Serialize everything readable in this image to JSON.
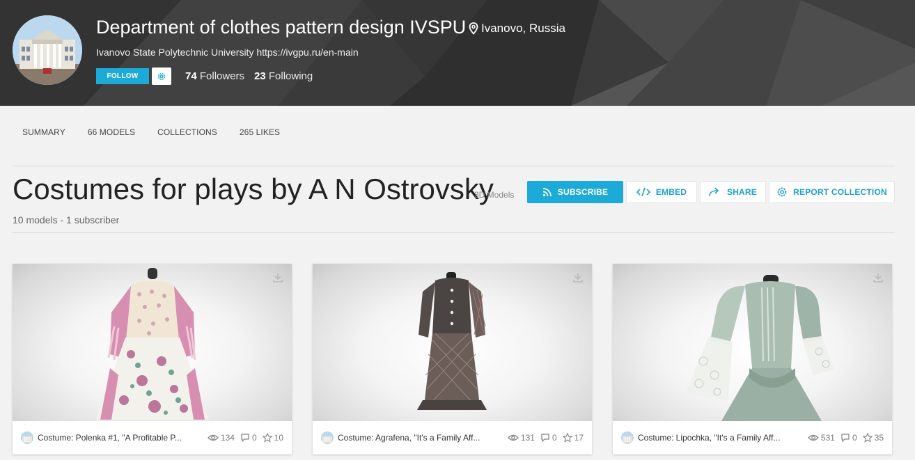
{
  "profile": {
    "name": "Department of clothes pattern design IVSPU",
    "location": "Ivanovo, Russia",
    "bio": "Ivanovo State Polytechnic University https://ivgpu.ru/en-main",
    "follow_label": "FOLLOW",
    "followers_count": "74",
    "followers_label": "Followers",
    "following_count": "23",
    "following_label": "Following"
  },
  "tabs": [
    {
      "label": "SUMMARY"
    },
    {
      "label": "66 MODELS"
    },
    {
      "label": "COLLECTIONS"
    },
    {
      "label": "265 LIKES"
    }
  ],
  "collection": {
    "title": "Costumes for plays by A N Ostrovsky",
    "type": "3D Models",
    "meta": "10 models - 1 subscriber",
    "actions": {
      "subscribe": "SUBSCRIBE",
      "embed": "EMBED",
      "share": "SHARE",
      "report": "REPORT COLLECTION"
    }
  },
  "models": [
    {
      "title": "Costume: Polenka #1, \"A Profitable P...",
      "views": "134",
      "comments": "0",
      "likes": "10"
    },
    {
      "title": "Costume: Agrafena, \"It's a Family Aff...",
      "views": "131",
      "comments": "0",
      "likes": "17"
    },
    {
      "title": "Costume: Lipochka, \"It's a Family Aff...",
      "views": "531",
      "comments": "0",
      "likes": "35"
    }
  ],
  "colors": {
    "accent": "#1caad9",
    "banner": "#3a3a3a",
    "page_bg": "#f2f2f2"
  },
  "icons": [
    "map-pin-icon",
    "gear-icon",
    "rss-icon",
    "code-icon",
    "share-arrow-icon",
    "eye-icon",
    "comment-icon",
    "star-icon",
    "download-icon"
  ]
}
